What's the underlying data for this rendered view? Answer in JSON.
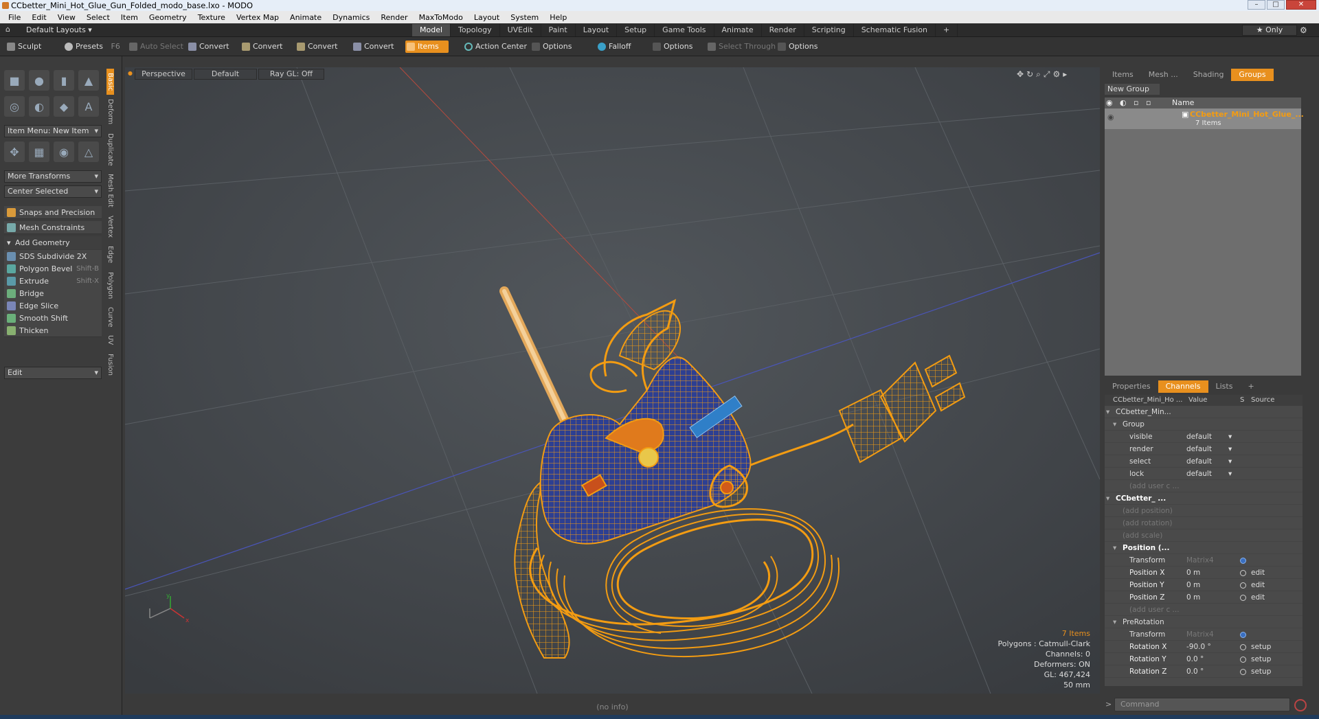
{
  "window": {
    "title": "CCbetter_Mini_Hot_Glue_Gun_Folded_modo_base.lxo - MODO",
    "buttons": [
      "–",
      "□",
      "✕"
    ]
  },
  "menu": [
    "File",
    "Edit",
    "View",
    "Select",
    "Item",
    "Geometry",
    "Texture",
    "Vertex Map",
    "Animate",
    "Dynamics",
    "Render",
    "MaxToModo",
    "Layout",
    "System",
    "Help"
  ],
  "layoutbar": {
    "layouts": "Default Layouts ▾",
    "tabs": [
      "Model",
      "Topology",
      "UVEdit",
      "Paint",
      "Layout",
      "Setup",
      "Game Tools",
      "Animate",
      "Render",
      "Scripting",
      "Schematic Fusion",
      "+"
    ],
    "only": "★ Only"
  },
  "toolbar": {
    "sculpt": "Sculpt",
    "presets": "Presets",
    "presets_key": "F6",
    "auto_select": "Auto Select",
    "convert1": "Convert",
    "convert2": "Convert",
    "convert3": "Convert",
    "convert4": "Convert",
    "items": "Items",
    "action_center": "Action Center",
    "options1": "Options",
    "falloff": "Falloff",
    "options2": "Options",
    "select_through": "Select Through",
    "options3": "Options"
  },
  "left": {
    "tabs": [
      "Basic",
      "Deform",
      "Duplicate",
      "Mesh Edit",
      "Vertex",
      "Edge",
      "Polygon",
      "Curve",
      "UV",
      "Fusion"
    ],
    "item_menu": "Item Menu: New Item",
    "more_transforms": "More Transforms",
    "center_selected": "Center Selected",
    "snaps": "Snaps and Precision",
    "mesh_constraints": "Mesh Constraints",
    "add_geometry": "Add Geometry",
    "tools": [
      {
        "label": "SDS Subdivide 2X",
        "shortcut": ""
      },
      {
        "label": "Polygon Bevel",
        "shortcut": "Shift-B"
      },
      {
        "label": "Extrude",
        "shortcut": "Shift-X"
      },
      {
        "label": "Bridge",
        "shortcut": ""
      },
      {
        "label": "Edge Slice",
        "shortcut": ""
      },
      {
        "label": "Smooth Shift",
        "shortcut": ""
      },
      {
        "label": "Thicken",
        "shortcut": ""
      }
    ],
    "edit": "Edit"
  },
  "viewport": {
    "view": "Perspective",
    "shading": "Default",
    "raygl": "Ray GL: Off"
  },
  "stats": {
    "items": "7 Items",
    "polygons": "Polygons : Catmull-Clark",
    "channels": "Channels: 0",
    "deformers": "Deformers: ON",
    "gl": "GL: 467,424",
    "focal": "50 mm"
  },
  "status": {
    "info": "(no info)",
    "command": "Command"
  },
  "groups": {
    "tabs": [
      "Items",
      "Mesh ...",
      "Shading",
      "Groups"
    ],
    "new_group": "New Group",
    "header": "Name",
    "group_name": "CCbetter_Mini_Hot_Glue_...",
    "group_count": "7 Items"
  },
  "channels": {
    "tabs": [
      "Properties",
      "Channels",
      "Lists",
      "+"
    ],
    "headers": [
      "CCbetter_Mini_Ho ...",
      "Value",
      "S",
      "Source"
    ],
    "rows": [
      {
        "name": "CCbetter_Min...",
        "value": "",
        "src": "",
        "indent": 1,
        "kind": "node"
      },
      {
        "name": "Group",
        "value": "",
        "src": "",
        "indent": 2,
        "kind": "node"
      },
      {
        "name": "visible",
        "value": "default",
        "src": "",
        "indent": 3,
        "kind": "drop"
      },
      {
        "name": "render",
        "value": "default",
        "src": "",
        "indent": 3,
        "kind": "drop"
      },
      {
        "name": "select",
        "value": "default",
        "src": "",
        "indent": 3,
        "kind": "drop"
      },
      {
        "name": "lock",
        "value": "default",
        "src": "",
        "indent": 3,
        "kind": "drop"
      },
      {
        "name": "(add user c ...",
        "value": "",
        "src": "",
        "indent": 3,
        "kind": "dim"
      },
      {
        "name": "CCbetter_ ...",
        "value": "",
        "src": "",
        "indent": 1,
        "kind": "bold"
      },
      {
        "name": "(add position)",
        "value": "",
        "src": "",
        "indent": 2,
        "kind": "dim"
      },
      {
        "name": "(add rotation)",
        "value": "",
        "src": "",
        "indent": 2,
        "kind": "dim"
      },
      {
        "name": "(add scale)",
        "value": "",
        "src": "",
        "indent": 2,
        "kind": "dim"
      },
      {
        "name": "Position (...",
        "value": "",
        "src": "",
        "indent": 2,
        "kind": "bold"
      },
      {
        "name": "Transform",
        "value": "Matrix4",
        "src": "",
        "indent": 3,
        "kind": "matrix"
      },
      {
        "name": "Position X",
        "value": "0 m",
        "src": "edit",
        "indent": 3,
        "kind": "val"
      },
      {
        "name": "Position Y",
        "value": "0 m",
        "src": "edit",
        "indent": 3,
        "kind": "val"
      },
      {
        "name": "Position Z",
        "value": "0 m",
        "src": "edit",
        "indent": 3,
        "kind": "val"
      },
      {
        "name": "(add user c ...",
        "value": "",
        "src": "",
        "indent": 3,
        "kind": "dim"
      },
      {
        "name": "PreRotation",
        "value": "",
        "src": "",
        "indent": 2,
        "kind": "node"
      },
      {
        "name": "Transform",
        "value": "Matrix4",
        "src": "",
        "indent": 3,
        "kind": "matrix"
      },
      {
        "name": "Rotation X",
        "value": "-90.0 °",
        "src": "setup",
        "indent": 3,
        "kind": "val"
      },
      {
        "name": "Rotation Y",
        "value": "0.0 °",
        "src": "setup",
        "indent": 3,
        "kind": "val"
      },
      {
        "name": "Rotation Z",
        "value": "0.0 °",
        "src": "setup",
        "indent": 3,
        "kind": "val"
      }
    ]
  },
  "colors": {
    "accent": "#e8901e",
    "wire": "#f39c12",
    "body": "#2b3f8f"
  }
}
